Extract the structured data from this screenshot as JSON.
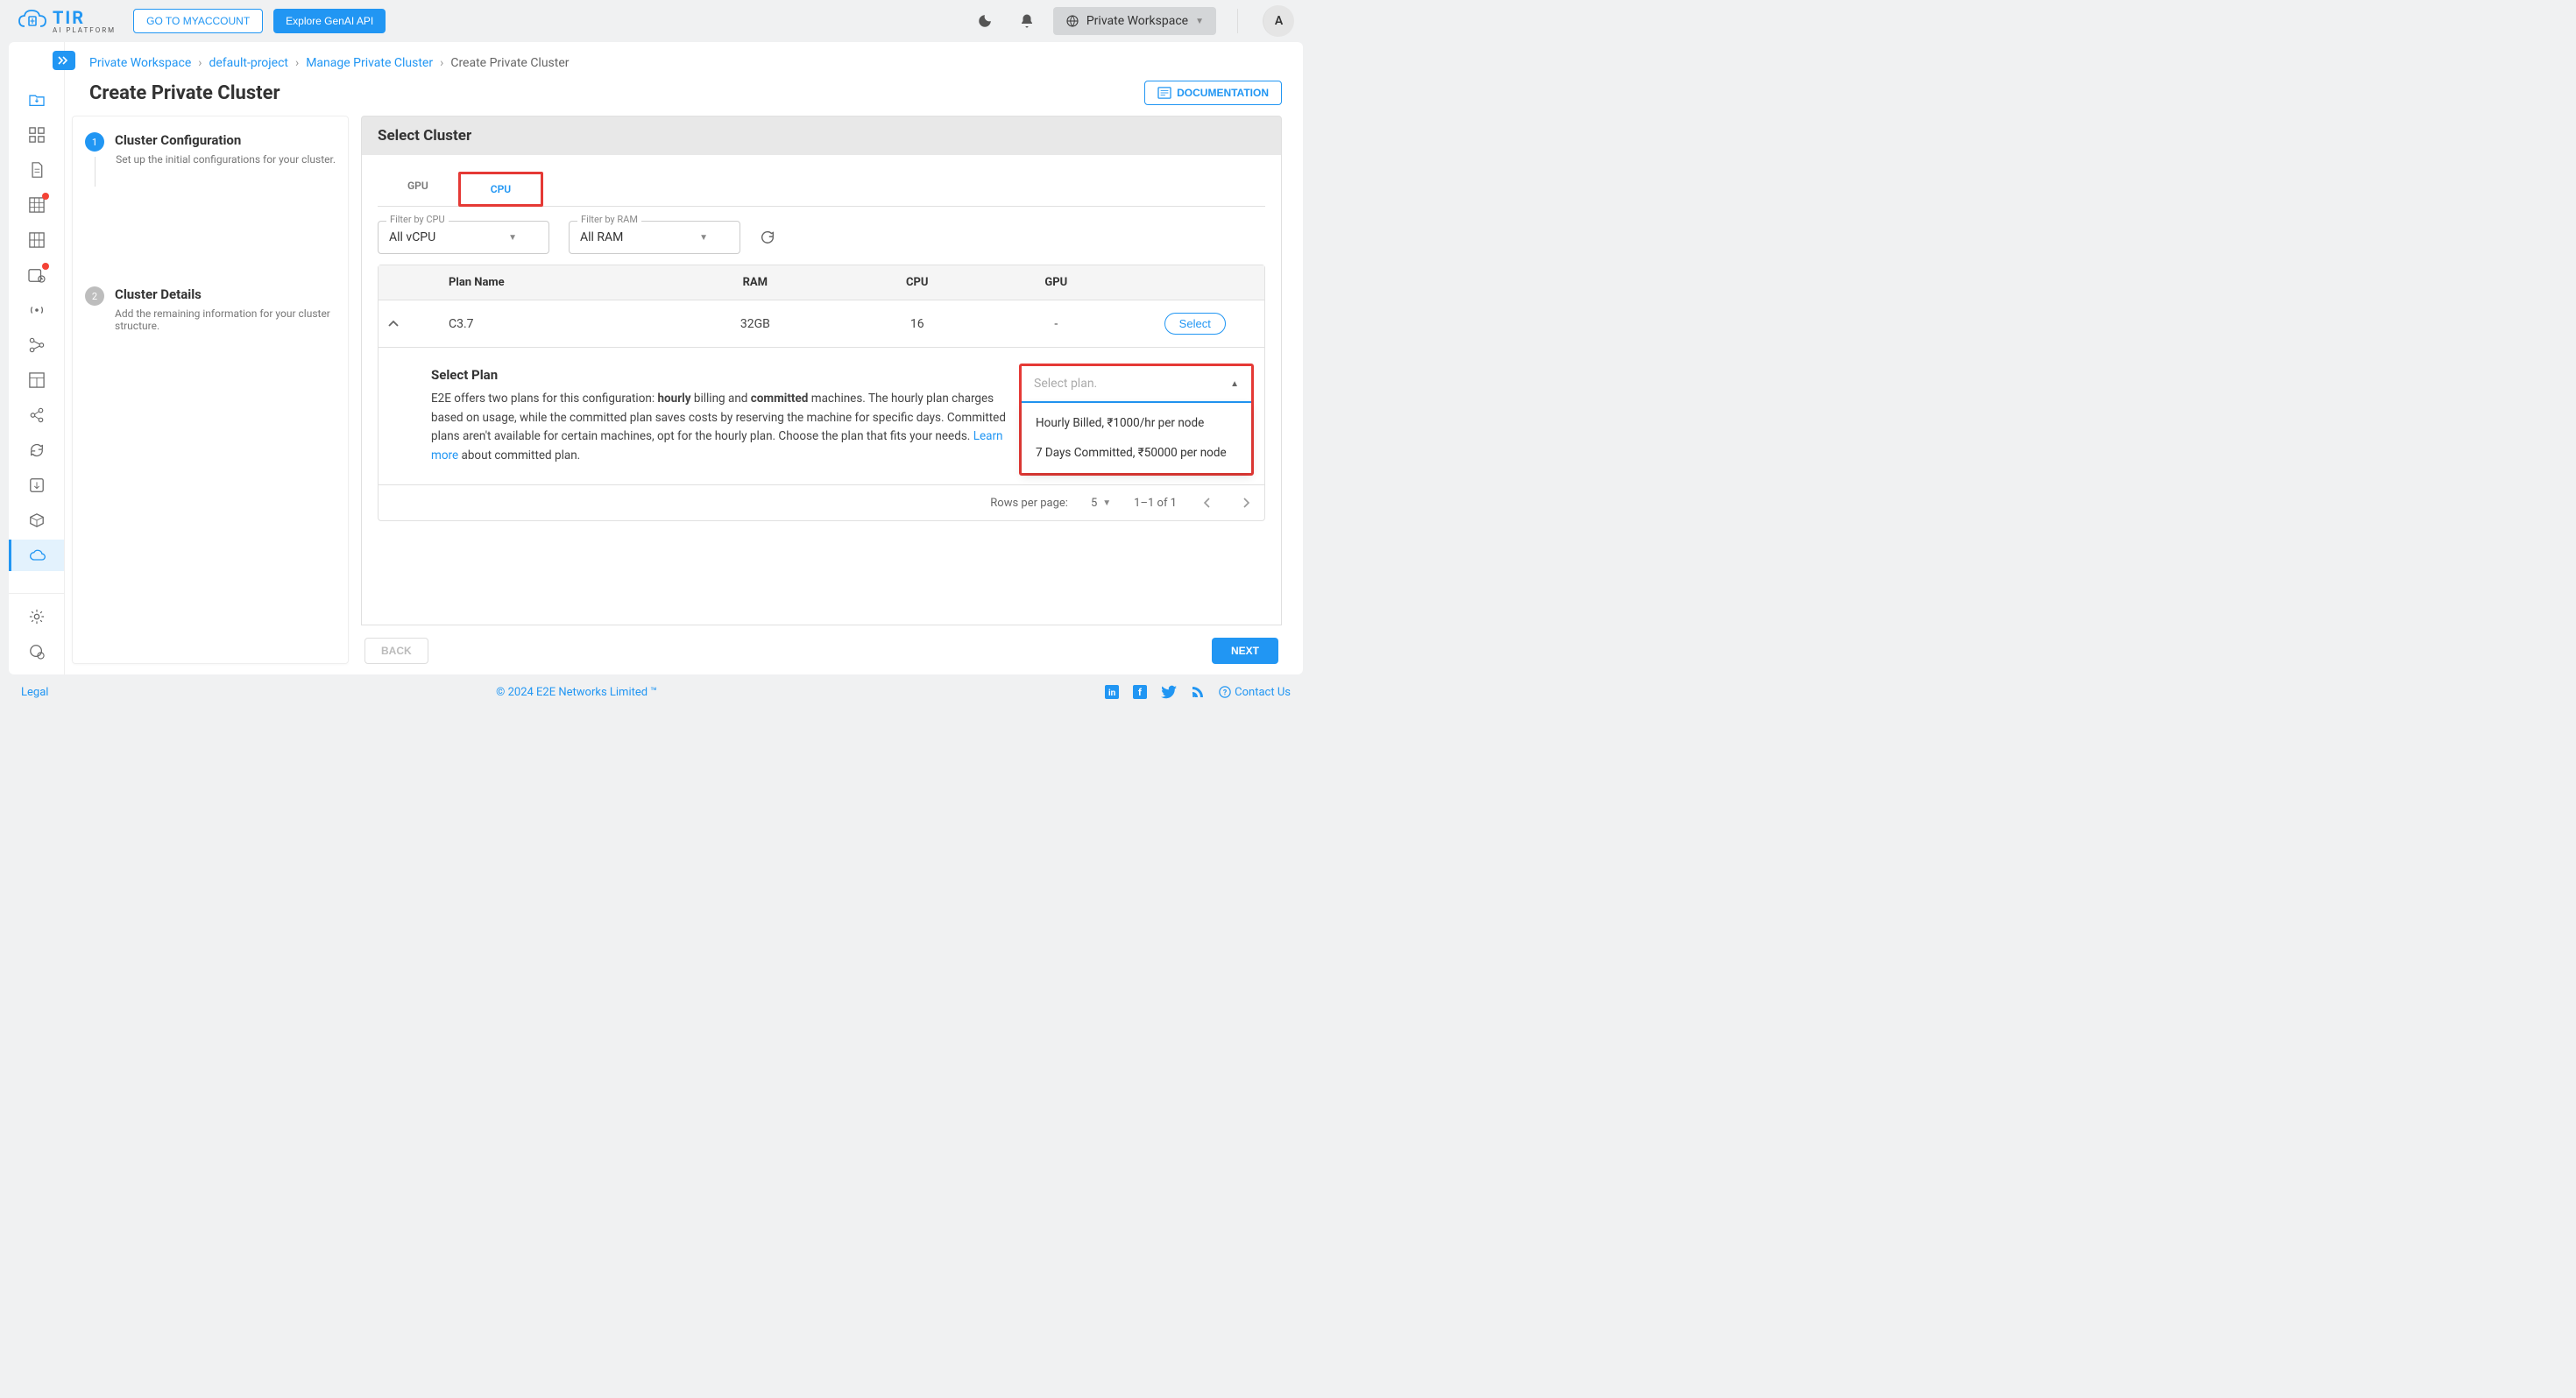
{
  "topbar": {
    "logo_text": "TIR",
    "logo_sub": "AI PLATFORM",
    "myaccount": "GO TO MYACCOUNT",
    "genai": "Explore GenAI API",
    "workspace_label": "Private Workspace",
    "avatar_letter": "A"
  },
  "breadcrumb": {
    "items": [
      "Private Workspace",
      "default-project",
      "Manage Private Cluster"
    ],
    "current": "Create Private Cluster"
  },
  "page": {
    "title": "Create Private Cluster",
    "doc_btn": "DOCUMENTATION"
  },
  "stepper": {
    "steps": [
      {
        "num": "1",
        "title": "Cluster Configuration",
        "desc": "Set up the initial configurations for your cluster."
      },
      {
        "num": "2",
        "title": "Cluster Details",
        "desc": "Add the remaining information for your cluster structure."
      }
    ]
  },
  "pane": {
    "header": "Select Cluster",
    "tabs": {
      "gpu": "GPU",
      "cpu": "CPU"
    },
    "filters": {
      "cpu_label": "Filter by CPU",
      "cpu_value": "All vCPU",
      "ram_label": "Filter by RAM",
      "ram_value": "All RAM"
    },
    "table": {
      "headers": {
        "plan": "Plan Name",
        "ram": "RAM",
        "cpu": "CPU",
        "gpu": "GPU"
      },
      "row": {
        "plan": "C3.7",
        "ram": "32GB",
        "cpu": "16",
        "gpu": "-",
        "select": "Select"
      }
    },
    "plan": {
      "title": "Select Plan",
      "d1a": "E2E offers two plans for this configuration: ",
      "d1b": "hourly",
      "d1c": " billing and ",
      "d1d": "committed",
      "d1e": " machines. The hourly plan charges based on usage, while the committed plan saves costs by reserving the machine for specific days. Committed plans aren't available for certain machines, opt for the hourly plan. Choose the plan that fits your needs. ",
      "learn": "Learn more",
      "d1f": " about committed plan.",
      "placeholder": "Select plan.",
      "options": [
        "Hourly Billed, ₹1000/hr per node",
        "7 Days Committed, ₹50000 per node"
      ]
    },
    "pagination": {
      "rpp_label": "Rows per page:",
      "rpp_value": "5",
      "range": "1–1 of 1"
    },
    "footer": {
      "back": "BACK",
      "next": "NEXT"
    }
  },
  "footer": {
    "legal": "Legal",
    "copy": "© 2024 E2E Networks Limited ™",
    "contact": "Contact Us"
  }
}
